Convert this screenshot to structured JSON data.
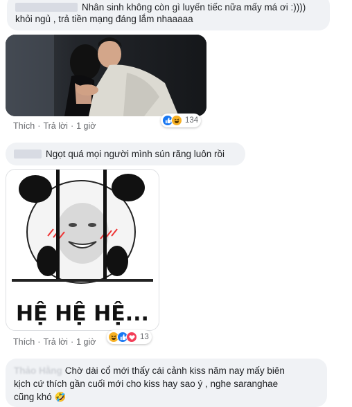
{
  "comments": [
    {
      "text_line1": "Nhân sinh không còn gì luyến tiếc nữa mấy má ơi :))))",
      "text_line2": "khỏi ngủ , trả tiền mạng đáng lắm nhaaaaa",
      "like": "Thích",
      "reply": "Trả lời",
      "time": "1 giờ",
      "reactions": {
        "icons": [
          "like",
          "haha"
        ],
        "count": "134"
      }
    },
    {
      "text": "Ngọt quá mọi người mình sún răng luôn rồi",
      "meme_caption": "HỆ HỆ HỆ...",
      "like": "Thích",
      "reply": "Trả lời",
      "time": "1 giờ",
      "reactions": {
        "icons": [
          "haha",
          "like",
          "love"
        ],
        "count": "13"
      }
    },
    {
      "author_blurred": "Thảo Hằng",
      "text_line1": "Chờ dài cổ mới thấy cái cảnh kiss năm nay mấy biên",
      "text_line2": "kịch cứ thích gần cuối mới cho kiss hay sao ý , nghe saranghae",
      "text_line3": "cũng khó 🤣"
    }
  ],
  "colors": {
    "bubble": "#f0f2f5",
    "meta_text": "#65676b",
    "like_blue": "#1877f2",
    "haha_yellow": "#f7b125",
    "love_red": "#f33e58"
  }
}
